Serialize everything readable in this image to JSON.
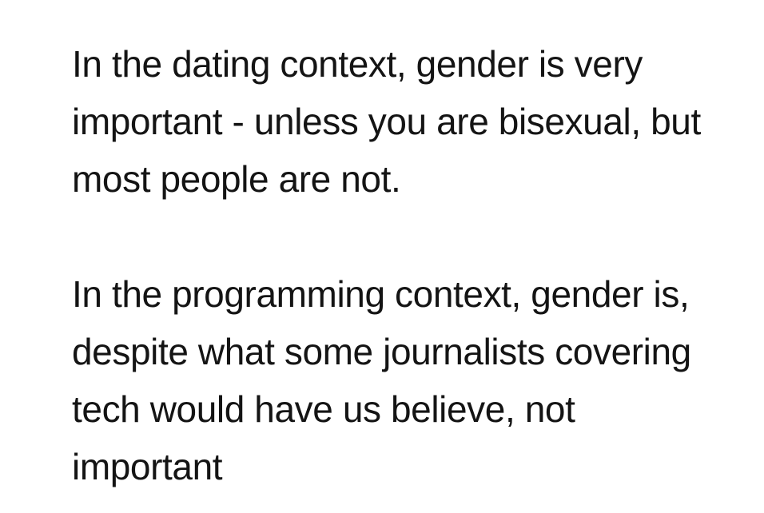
{
  "post": {
    "paragraphs": [
      "In the dating context, gender is very\nimportant - unless you are bisexual, but\nmost people are not.",
      "In the programming context, gender is,\ndespite what some journalists covering\ntech would have us believe, not\nimportant"
    ]
  }
}
